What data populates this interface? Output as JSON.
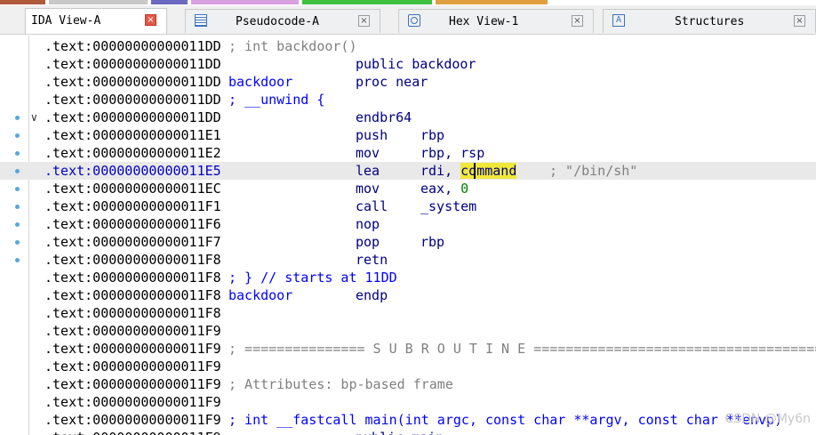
{
  "colors": {
    "legend": [
      "#b05a3a",
      "#c8c8c8",
      "#6a6ac0",
      "#d8a0e0",
      "#40c040",
      "#e0a040"
    ],
    "highlight": "#f0e838",
    "current_line": "#e9e9e9",
    "comment_blue": "#0000ff",
    "comment_gray": "#808080",
    "active_tab_close": "#e05a4a"
  },
  "tabs": [
    {
      "label": "IDA View-A",
      "icon": "",
      "close": "×",
      "active": true
    },
    {
      "label": "Pseudocode-A",
      "icon": "pseudocode-icon",
      "close": "×",
      "active": false
    },
    {
      "label": "Hex View-1",
      "icon": "hex-icon",
      "close": "×",
      "active": false
    },
    {
      "label": "Structures",
      "icon": "structures-icon",
      "glyph": "A",
      "close": "×",
      "active": false
    }
  ],
  "lines": [
    {
      "addr": ".text:00000000000011DD",
      "cmt": "; int backdoor()",
      "gray": true
    },
    {
      "addr": ".text:00000000000011DD",
      "mnem": "public backdoor"
    },
    {
      "addr": ".text:00000000000011DD",
      "lab": "backdoor",
      "mnem": "proc near"
    },
    {
      "addr": ".text:00000000000011DD",
      "cmt": "; __unwind {"
    },
    {
      "addr": ".text:00000000000011DD",
      "dot": true,
      "fold": "v",
      "mnem": "endbr64"
    },
    {
      "addr": ".text:00000000000011E1",
      "dot": true,
      "mnem": "push",
      "ops": "rbp"
    },
    {
      "addr": ".text:00000000000011E2",
      "dot": true,
      "mnem": "mov",
      "ops": "rbp, rsp"
    },
    {
      "addr": ".text:00000000000011E5",
      "dot": true,
      "mnem": "lea",
      "ops_pre": "rdi, ",
      "ops_hl": "command",
      "tail": "; \"/bin/sh\"",
      "current": true
    },
    {
      "addr": ".text:00000000000011EC",
      "dot": true,
      "mnem": "mov",
      "ops_pre": "eax, ",
      "ops_num": "0"
    },
    {
      "addr": ".text:00000000000011F1",
      "dot": true,
      "mnem": "call",
      "ops": "_system"
    },
    {
      "addr": ".text:00000000000011F6",
      "dot": true,
      "mnem": "nop"
    },
    {
      "addr": ".text:00000000000011F7",
      "dot": true,
      "mnem": "pop",
      "ops": "rbp"
    },
    {
      "addr": ".text:00000000000011F8",
      "dot": true,
      "mnem": "retn"
    },
    {
      "addr": ".text:00000000000011F8",
      "cmt": "; } // starts at 11DD"
    },
    {
      "addr": ".text:00000000000011F8",
      "lab": "backdoor",
      "mnem": "endp"
    },
    {
      "addr": ".text:00000000000011F8"
    },
    {
      "addr": ".text:00000000000011F9"
    },
    {
      "addr": ".text:00000000000011F9",
      "cmt": "; =============== S U B R O U T I N E =======================================",
      "gray": true
    },
    {
      "addr": ".text:00000000000011F9"
    },
    {
      "addr": ".text:00000000000011F9",
      "cmt": "; Attributes: bp-based frame",
      "gray": true
    },
    {
      "addr": ".text:00000000000011F9"
    },
    {
      "addr": ".text:00000000000011F9",
      "cmt": "; int __fastcall main(int argc, const char **argv, const char **envp)"
    },
    {
      "addr": ".text:00000000000011F9",
      "mnem": "public main"
    }
  ],
  "watermark": "CSDN @My6n"
}
